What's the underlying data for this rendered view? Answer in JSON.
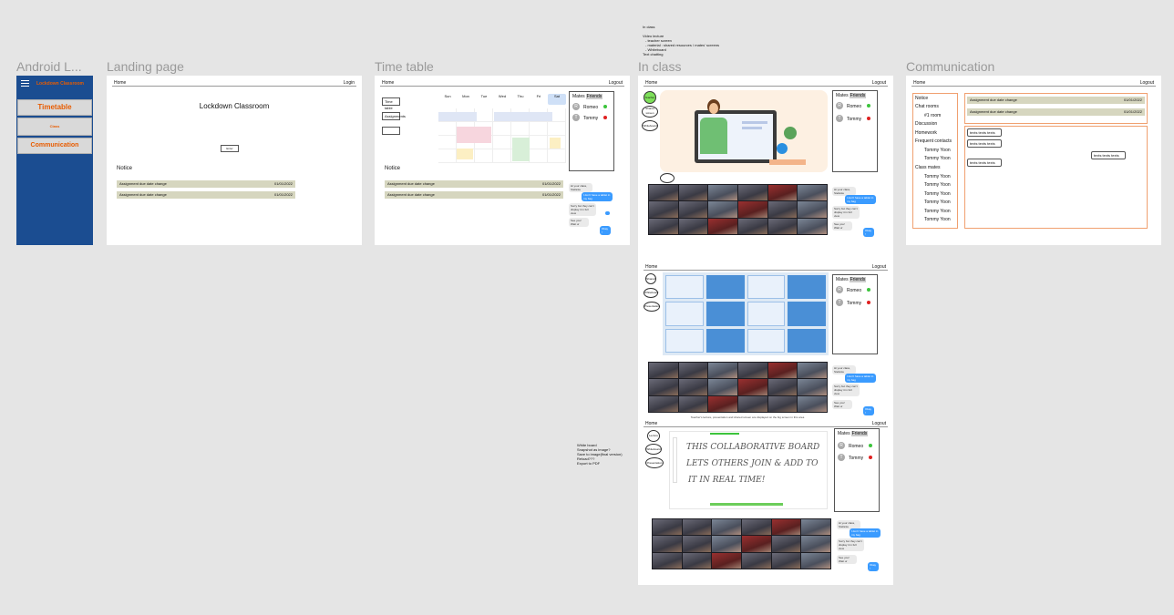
{
  "frames": {
    "android": {
      "title": "Android L..."
    },
    "landing": {
      "title": "Landing page"
    },
    "timetable": {
      "title": "Time table"
    },
    "inclass": {
      "title": "In class"
    },
    "communication": {
      "title": "Communication"
    }
  },
  "android": {
    "app_title": "Lockdown Classroom",
    "items": [
      "Timetable",
      "Class",
      "Communication"
    ],
    "accent": "#e85c00",
    "bg": "#1b4d91"
  },
  "landing": {
    "home": "Home",
    "login": "Login",
    "heading": "Lockdown Classroom",
    "button": "Enter",
    "notice_title": "Notice",
    "notices": [
      {
        "text": "Assignment due date change",
        "date": "01/01/2022"
      },
      {
        "text": "Assignment due date change",
        "date": "01/01/2022"
      }
    ]
  },
  "timetable": {
    "home": "Home",
    "logout": "Logout",
    "left_buttons": [
      "Time table",
      "Assignments",
      ""
    ],
    "days": [
      "Sun",
      "Mon",
      "Tue",
      "Wed",
      "Thu",
      "Fri",
      "Sat"
    ],
    "notice_title": "Notice",
    "notices": [
      {
        "text": "Assignment due date change",
        "date": "01/01/2022"
      },
      {
        "text": "Assignment due date change",
        "date": "01/01/2022"
      }
    ]
  },
  "side": {
    "tabs": [
      "Mates",
      "Friends"
    ],
    "users": [
      {
        "initial": "R",
        "name": "Romeo",
        "status": "#3cc43c"
      },
      {
        "initial": "T",
        "name": "Tommy",
        "status": "#e02020"
      }
    ]
  },
  "chat": {
    "messages": [
      "Hi your class, Stefanie",
      "I don't have a tablet in my bag",
      "Sorry but they can't display it in full view",
      "See you! Wait ur",
      "Okay !"
    ]
  },
  "inclass": {
    "notes": {
      "title": "In class",
      "lines": [
        "Video lecture",
        "- teacher screen",
        "- material : shared resources / mates' screens",
        "- Whiteboard",
        "Text chatting"
      ]
    },
    "home": "Home",
    "logout": "Logout",
    "circles1": [
      "Teacher",
      "Shared screen",
      "Whiteboard"
    ],
    "circles2": [
      "Shared",
      "Whiteboard",
      "Presentation"
    ],
    "circles3": [
      "Lecture",
      "Whiteboard",
      "Presentation"
    ],
    "caption": "Teacher's lecture, presentation and shared screen are displayed on the big screen in this area",
    "whiteboard_lines": [
      "THIS COLLABORATIVE BOARD",
      "LETS OTHERS JOIN & ADD TO",
      "IT IN REAL TIME!"
    ]
  },
  "wb_notes": {
    "lines": [
      "White board",
      "Snapshot as image?",
      "Save to image(final version)",
      "Reload???",
      "Export to PDF"
    ]
  },
  "communication": {
    "home": "Home",
    "logout": "Logout",
    "menu": [
      "Notice",
      "Chat rooms",
      "#1 room",
      "Discussion",
      "Homework",
      "Frequent contacts",
      "Tommy Yoon",
      "Tommy Yoon",
      "Class mates",
      "Tommy Yoon",
      "Tommy Yoon",
      "Tommy Yoon",
      "Tommy Yoon",
      "Tommy Yoon",
      "Tommy Yoon"
    ],
    "notices": [
      {
        "text": "Assignment due date change",
        "date": "01/01/2022"
      },
      {
        "text": "Assignment due date change",
        "date": "01/01/2022"
      }
    ],
    "chat_boxes": [
      "texts texts texts",
      "texts texts texts",
      "texts texts texts",
      "texts texts texts"
    ],
    "accent": "#f0a070"
  }
}
